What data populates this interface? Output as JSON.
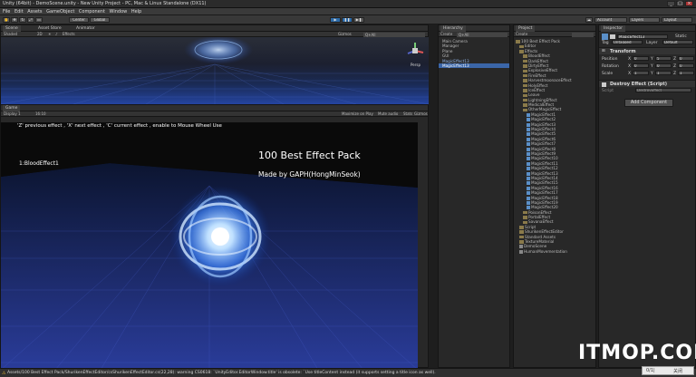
{
  "window": {
    "title": "Unity (64bit) - DemoScene.unity - New Unity Project - PC, Mac & Linux Standalone (DX11)",
    "minimize": "_",
    "maximize": "□",
    "close": "×"
  },
  "menu": [
    "File",
    "Edit",
    "Assets",
    "GameObject",
    "Component",
    "Window",
    "Help"
  ],
  "toolbar": {
    "pivot": "Center",
    "space": "Global",
    "account": "Account",
    "layers": "Layers",
    "layout": "Layout"
  },
  "scene": {
    "tabs": [
      "Scene",
      "Asset Store",
      "Animator"
    ],
    "shading": "Shaded",
    "mode_2d": "2D",
    "effects": "Effects",
    "gizmos": "Gizmos",
    "search": "Q+All",
    "gizmo_label": "Persp"
  },
  "game": {
    "tab": "Game",
    "display": "Display 1",
    "aspect": "16:10",
    "maximize": "Maximize on Play",
    "mute": "Mute audio",
    "stats": "Stats",
    "gizmos": "Gizmos",
    "instructions": "'Z' previous effect , 'X' next effect , 'C' current effect , enable to Mouse Wheel Use",
    "current_effect": "1:BloodEffect1",
    "heading": "100 Best Effect Pack",
    "credit": "Made by GAPH(HongMinSeok)"
  },
  "hierarchy": {
    "tab": "Hierarchy",
    "create": "Create",
    "search": "Q+All",
    "items": [
      "Main Camera",
      "Manager",
      "Plane",
      "GUI",
      "MagicEffect13",
      "MagicEffect13"
    ],
    "selected_index": 5
  },
  "project": {
    "tab": "Project",
    "create": "Create",
    "items": [
      {
        "label": "100 Best Effect Pack",
        "depth": 0,
        "type": "folder"
      },
      {
        "label": "Editor",
        "depth": 1,
        "type": "folder"
      },
      {
        "label": "Effects",
        "depth": 1,
        "type": "folder"
      },
      {
        "label": "BloodEffect",
        "depth": 2,
        "type": "folder"
      },
      {
        "label": "DarkEffect",
        "depth": 2,
        "type": "folder"
      },
      {
        "label": "DirtyEffect",
        "depth": 2,
        "type": "folder"
      },
      {
        "label": "ExplosiveEffect",
        "depth": 2,
        "type": "folder"
      },
      {
        "label": "FireEffect",
        "depth": 2,
        "type": "folder"
      },
      {
        "label": "HarvestmoonaceEffect",
        "depth": 2,
        "type": "folder"
      },
      {
        "label": "HolyEffect",
        "depth": 2,
        "type": "folder"
      },
      {
        "label": "IceEffect",
        "depth": 2,
        "type": "folder"
      },
      {
        "label": "Leave",
        "depth": 2,
        "type": "folder"
      },
      {
        "label": "LightningEffect",
        "depth": 2,
        "type": "folder"
      },
      {
        "label": "MedicalEffect",
        "depth": 2,
        "type": "folder"
      },
      {
        "label": "OtherMagicEffect",
        "depth": 2,
        "type": "folder"
      },
      {
        "label": "MagicEffect1",
        "depth": 3,
        "type": "prefab"
      },
      {
        "label": "MagicEffect2",
        "depth": 3,
        "type": "prefab"
      },
      {
        "label": "MagicEffect3",
        "depth": 3,
        "type": "prefab"
      },
      {
        "label": "MagicEffect4",
        "depth": 3,
        "type": "prefab"
      },
      {
        "label": "MagicEffect5",
        "depth": 3,
        "type": "prefab"
      },
      {
        "label": "MagicEffect6",
        "depth": 3,
        "type": "prefab"
      },
      {
        "label": "MagicEffect7",
        "depth": 3,
        "type": "prefab"
      },
      {
        "label": "MagicEffect8",
        "depth": 3,
        "type": "prefab"
      },
      {
        "label": "MagicEffect9",
        "depth": 3,
        "type": "prefab"
      },
      {
        "label": "MagicEffect10",
        "depth": 3,
        "type": "prefab"
      },
      {
        "label": "MagicEffect11",
        "depth": 3,
        "type": "prefab"
      },
      {
        "label": "MagicEffect12",
        "depth": 3,
        "type": "prefab"
      },
      {
        "label": "MagicEffect13",
        "depth": 3,
        "type": "prefab"
      },
      {
        "label": "MagicEffect14",
        "depth": 3,
        "type": "prefab"
      },
      {
        "label": "MagicEffect15",
        "depth": 3,
        "type": "prefab"
      },
      {
        "label": "MagicEffect16",
        "depth": 3,
        "type": "prefab"
      },
      {
        "label": "MagicEffect17",
        "depth": 3,
        "type": "prefab"
      },
      {
        "label": "MagicEffect18",
        "depth": 3,
        "type": "prefab"
      },
      {
        "label": "MagicEffect19",
        "depth": 3,
        "type": "prefab"
      },
      {
        "label": "MagicEffect20",
        "depth": 3,
        "type": "prefab"
      },
      {
        "label": "PoisonEffect",
        "depth": 2,
        "type": "folder"
      },
      {
        "label": "PortalEffect",
        "depth": 2,
        "type": "folder"
      },
      {
        "label": "SavanaEffect",
        "depth": 2,
        "type": "folder"
      },
      {
        "label": "Script",
        "depth": 1,
        "type": "folder"
      },
      {
        "label": "ShurikenEffectEditor",
        "depth": 1,
        "type": "folder"
      },
      {
        "label": "Standard Assets",
        "depth": 1,
        "type": "folder"
      },
      {
        "label": "TextureMaterial",
        "depth": 1,
        "type": "folder"
      },
      {
        "label": "DemoScene",
        "depth": 1,
        "type": "scene"
      },
      {
        "label": "HumanMovementation",
        "depth": 1,
        "type": "scene"
      }
    ]
  },
  "inspector": {
    "tab": "Inspector",
    "object_name": "MagicEffect13",
    "static": "Static",
    "tag_label": "Tag",
    "tag_value": "Untagged",
    "layer_label": "Layer",
    "layer_value": "Default",
    "transform": {
      "title": "Transform",
      "rows": [
        {
          "label": "Position",
          "x": "0",
          "y": "5",
          "z": "0"
        },
        {
          "label": "Rotation",
          "x": "0",
          "y": "0",
          "z": "0"
        },
        {
          "label": "Scale",
          "x": "1",
          "y": "1",
          "z": "1"
        }
      ]
    },
    "script": {
      "title": "Destroy Effect (Script)",
      "field_label": "Script",
      "field_value": "DestroyEffect"
    },
    "add_component": "Add Component"
  },
  "status": {
    "message": "Assets/100 Best Effect Pack/ShurikenEffectEditor/csShurikenEffectEditor.cs(22,28): warning CS0618: `UnityEditor.EditorWindow.title' is obsolete: `Use titleContent instead (it supports setting a title icon as well)."
  },
  "watermark": "ITMOP.COM",
  "popup": {
    "label": "0/1|",
    "close": "关闭"
  },
  "colors": {
    "accent": "#3b66a8",
    "play": "#2c6aa8",
    "glow": "#7fb4ff"
  }
}
